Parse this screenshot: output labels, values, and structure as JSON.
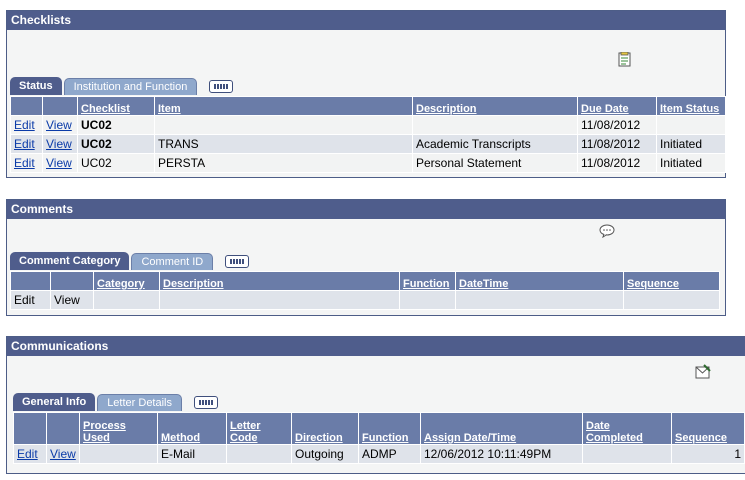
{
  "checklists": {
    "title": "Checklists",
    "tabs": [
      "Status",
      "Institution and Function"
    ],
    "headers": [
      "Checklist",
      "Item",
      "Description",
      "Due Date",
      "Item Status"
    ],
    "rows": [
      {
        "edit": "Edit",
        "view": "View",
        "checklist": "UC02",
        "item": "",
        "description": "",
        "due": "11/08/2012",
        "status": ""
      },
      {
        "edit": "Edit",
        "view": "View",
        "checklist": "UC02",
        "item": "TRANS",
        "description": "Academic Transcripts",
        "due": "11/08/2012",
        "status": "Initiated"
      },
      {
        "edit": "Edit",
        "view": "View",
        "checklist": "UC02",
        "item": "PERSTA",
        "description": "Personal Statement",
        "due": "11/08/2012",
        "status": "Initiated"
      }
    ]
  },
  "comments": {
    "title": "Comments",
    "tabs": [
      "Comment Category",
      "Comment ID"
    ],
    "headers": [
      "Category",
      "Description",
      "Function",
      "DateTime",
      "Sequence"
    ],
    "rows": [
      {
        "edit": "Edit",
        "view": "View"
      }
    ]
  },
  "communications": {
    "title": "Communications",
    "tabs": [
      "General Info",
      "Letter Details"
    ],
    "headers": [
      "Process Used",
      "Method",
      "Letter Code",
      "Direction",
      "Function",
      "Assign Date/Time",
      "Date Completed",
      "Sequence"
    ],
    "rows": [
      {
        "edit": "Edit",
        "view": "View",
        "process": "",
        "method": "E-Mail",
        "letter": "",
        "direction": "Outgoing",
        "function": "ADMP",
        "assign": "12/06/2012 10:11:49PM",
        "completed": "",
        "sequence": "1"
      }
    ]
  }
}
